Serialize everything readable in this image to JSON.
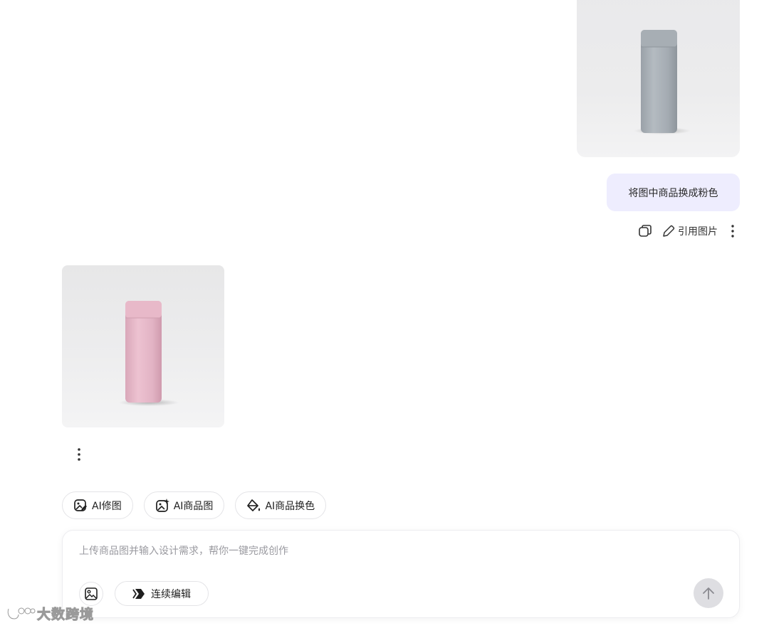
{
  "chat": {
    "user_message": "将图中商品换成粉色",
    "actions": {
      "quote_image_label": "引用图片"
    }
  },
  "tools": [
    {
      "label": "AI修图",
      "icon": "image-edit-icon"
    },
    {
      "label": "AI商品图",
      "icon": "image-sparkle-icon"
    },
    {
      "label": "AI商品换色",
      "icon": "paint-bucket-icon"
    }
  ],
  "composer": {
    "placeholder": "上传商品图并输入设计需求，帮你一键完成创作",
    "continuous_edit_label": "连续编辑"
  },
  "watermark": {
    "text": "大数跨境"
  },
  "colors": {
    "user_bubble_bg": "#eeedfe",
    "send_button_bg": "#dedee2",
    "product_original": "#a9b0b6",
    "product_result": "#e4b8c8"
  }
}
